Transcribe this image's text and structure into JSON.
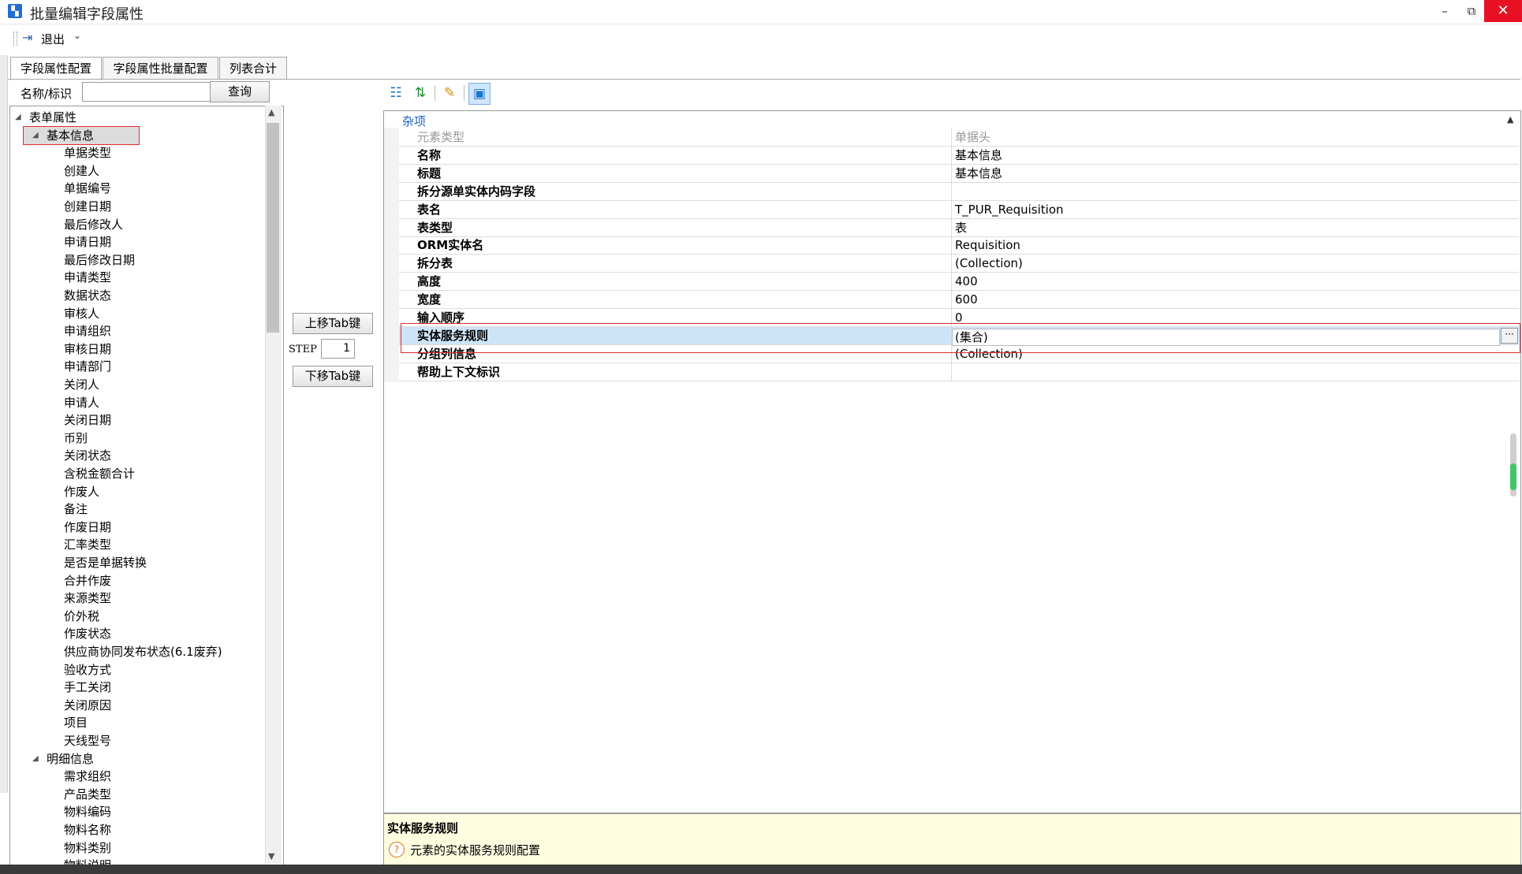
{
  "window": {
    "title": "批量编辑字段属性",
    "minimize_icon": "minimize-icon",
    "restore_icon": "restore-icon",
    "close_icon": "close-icon"
  },
  "toolbar": {
    "exit_label": "退出"
  },
  "tabs": [
    {
      "label": "字段属性配置",
      "active": true
    },
    {
      "label": "字段属性批量配置",
      "active": false
    },
    {
      "label": "列表合计",
      "active": false
    }
  ],
  "search": {
    "label": "名称/标识",
    "value": "",
    "query_button": "查询"
  },
  "tree": {
    "root": "表单属性",
    "groups": [
      {
        "label": "基本信息",
        "selected": true,
        "items": [
          "单据类型",
          "创建人",
          "单据编号",
          "创建日期",
          "最后修改人",
          "申请日期",
          "最后修改日期",
          "申请类型",
          "数据状态",
          "审核人",
          "申请组织",
          "审核日期",
          "申请部门",
          "关闭人",
          "申请人",
          "关闭日期",
          "币别",
          "关闭状态",
          "含税金额合计",
          "作废人",
          "备注",
          "作废日期",
          "汇率类型",
          "是否是单据转换",
          "合并作废",
          "来源类型",
          "价外税",
          "作废状态",
          "供应商协同发布状态(6.1废弃)",
          "验收方式",
          "手工关闭",
          "关闭原因",
          "项目",
          "天线型号"
        ]
      },
      {
        "label": "明细信息",
        "selected": false,
        "items": [
          "需求组织",
          "产品类型",
          "物料编码",
          "物料名称",
          "物料类别",
          "物料说明"
        ]
      }
    ]
  },
  "middle": {
    "up_button": "上移Tab键",
    "step_label": "STEP",
    "step_value": "1",
    "down_button": "下移Tab键"
  },
  "property_grid": {
    "category": "杂项",
    "rows": [
      {
        "name": "元素类型",
        "value": "单据头",
        "readonly": true
      },
      {
        "name": "名称",
        "value": "基本信息"
      },
      {
        "name": "标题",
        "value": "基本信息"
      },
      {
        "name": "拆分源单实体内码字段",
        "value": ""
      },
      {
        "name": "表名",
        "value": "T_PUR_Requisition"
      },
      {
        "name": "表类型",
        "value": "表"
      },
      {
        "name": "ORM实体名",
        "value": "Requisition"
      },
      {
        "name": "拆分表",
        "value": "(Collection)"
      },
      {
        "name": "高度",
        "value": "400"
      },
      {
        "name": "宽度",
        "value": "600"
      },
      {
        "name": "输入顺序",
        "value": "0"
      },
      {
        "name": "实体服务规则",
        "value": "(集合)",
        "selected": true
      },
      {
        "name": "分组列信息",
        "value": "(Collection)"
      },
      {
        "name": "帮助上下文标识",
        "value": ""
      }
    ],
    "ellipsis_label": "···"
  },
  "description": {
    "title": "实体服务规则",
    "text": "元素的实体服务规则配置"
  }
}
